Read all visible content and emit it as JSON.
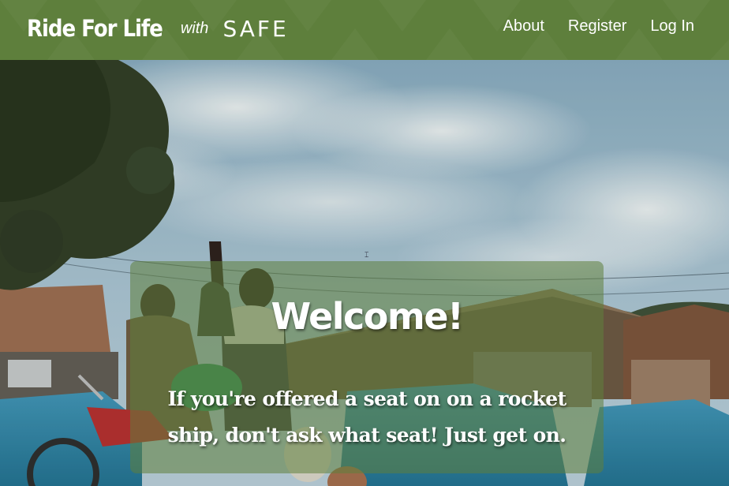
{
  "header": {
    "brand_title": "Ride For Life",
    "brand_with": "with",
    "brand_partner": "SAFE",
    "background_color": "#5e7f3c"
  },
  "nav": {
    "items": [
      {
        "label": "About"
      },
      {
        "label": "Register"
      },
      {
        "label": "Log In"
      }
    ]
  },
  "hero": {
    "card_title": "Welcome!",
    "card_quote": "If you're offered a seat on on a rocket ship, don't ask what seat! Just get on."
  }
}
